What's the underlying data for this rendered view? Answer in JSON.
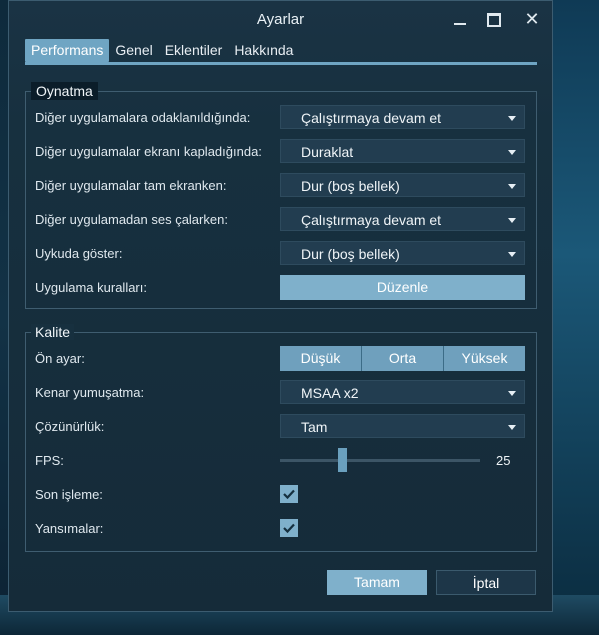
{
  "window": {
    "title": "Ayarlar"
  },
  "tabs": [
    {
      "label": "Performans",
      "active": true
    },
    {
      "label": "Genel",
      "active": false
    },
    {
      "label": "Eklentiler",
      "active": false
    },
    {
      "label": "Hakkında",
      "active": false
    }
  ],
  "playback": {
    "title": "Oynatma",
    "rows": [
      {
        "label": "Diğer uygulamalara odaklanıldığında:",
        "value": "Çalıştırmaya devam et"
      },
      {
        "label": "Diğer uygulamalar ekranı kapladığında:",
        "value": "Duraklat"
      },
      {
        "label": "Diğer uygulamalar tam ekranken:",
        "value": "Dur (boş bellek)"
      },
      {
        "label": "Diğer uygulamadan ses çalarken:",
        "value": "Çalıştırmaya devam et"
      },
      {
        "label": "Uykuda göster:",
        "value": "Dur (boş bellek)"
      }
    ],
    "rules_label": "Uygulama kuralları:",
    "edit_button": "Düzenle"
  },
  "quality": {
    "title": "Kalite",
    "preset_label": "Ön ayar:",
    "presets": [
      "Düşük",
      "Orta",
      "Yüksek"
    ],
    "antialias_label": "Kenar yumuşatma:",
    "antialias_value": "MSAA x2",
    "resolution_label": "Çözünürlük:",
    "resolution_value": "Tam",
    "fps_label": "FPS:",
    "fps_value": "25",
    "postprocess_label": "Son işleme:",
    "postprocess_checked": true,
    "reflections_label": "Yansımalar:",
    "reflections_checked": true
  },
  "footer": {
    "ok_label": "Tamam",
    "cancel_label": "İptal"
  },
  "colors": {
    "accent": "#7fb0cb",
    "panel": "#17303f",
    "select_bg": "#223d50"
  }
}
